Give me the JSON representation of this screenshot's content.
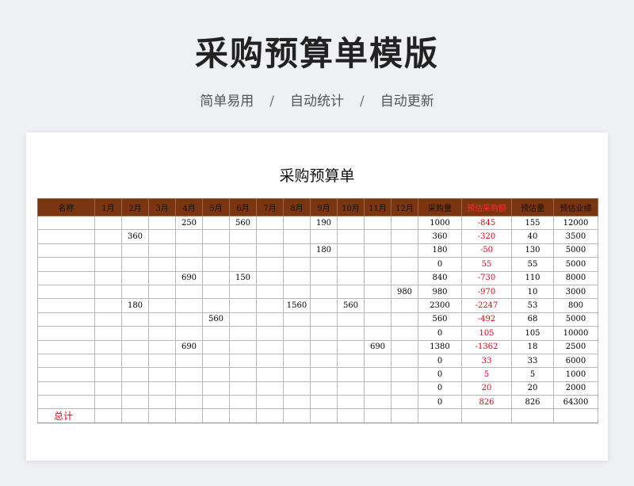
{
  "header": {
    "title": "采购预算单模版",
    "tags": [
      "简单易用",
      "自动统计",
      "自动更新"
    ],
    "separator": "/"
  },
  "sheet": {
    "title": "采购预算单",
    "columns": [
      "名称",
      "1月",
      "2月",
      "3月",
      "4月",
      "5月",
      "6月",
      "7月",
      "8月",
      "9月",
      "10月",
      "11月",
      "12月",
      "采购量",
      "预估采购额",
      "预估量",
      "预估业绩"
    ],
    "highlight_column_index": 14,
    "rows": [
      [
        "",
        "",
        "",
        "",
        "250",
        "",
        "560",
        "",
        "",
        "190",
        "",
        "",
        "",
        "1000",
        "-845",
        "155",
        "12000"
      ],
      [
        "",
        "",
        "360",
        "",
        "",
        "",
        "",
        "",
        "",
        "",
        "",
        "",
        "",
        "360",
        "-320",
        "40",
        "3500"
      ],
      [
        "",
        "",
        "",
        "",
        "",
        "",
        "",
        "",
        "",
        "180",
        "",
        "",
        "",
        "180",
        "-50",
        "130",
        "5000"
      ],
      [
        "",
        "",
        "",
        "",
        "",
        "",
        "",
        "",
        "",
        "",
        "",
        "",
        "",
        "0",
        "55",
        "55",
        "5000"
      ],
      [
        "",
        "",
        "",
        "",
        "690",
        "",
        "150",
        "",
        "",
        "",
        "",
        "",
        "",
        "840",
        "-730",
        "110",
        "8000"
      ],
      [
        "",
        "",
        "",
        "",
        "",
        "",
        "",
        "",
        "",
        "",
        "",
        "",
        "980",
        "980",
        "-970",
        "10",
        "3000"
      ],
      [
        "",
        "",
        "180",
        "",
        "",
        "",
        "",
        "",
        "1560",
        "",
        "560",
        "",
        "",
        "2300",
        "-2247",
        "53",
        "800"
      ],
      [
        "",
        "",
        "",
        "",
        "",
        "560",
        "",
        "",
        "",
        "",
        "",
        "",
        "",
        "560",
        "-492",
        "68",
        "5000"
      ],
      [
        "",
        "",
        "",
        "",
        "",
        "",
        "",
        "",
        "",
        "",
        "",
        "",
        "",
        "0",
        "105",
        "105",
        "10000"
      ],
      [
        "",
        "",
        "",
        "",
        "690",
        "",
        "",
        "",
        "",
        "",
        "",
        "690",
        "",
        "1380",
        "-1362",
        "18",
        "2500"
      ],
      [
        "",
        "",
        "",
        "",
        "",
        "",
        "",
        "",
        "",
        "",
        "",
        "",
        "",
        "0",
        "33",
        "33",
        "6000"
      ],
      [
        "",
        "",
        "",
        "",
        "",
        "",
        "",
        "",
        "",
        "",
        "",
        "",
        "",
        "0",
        "5",
        "5",
        "1000"
      ],
      [
        "",
        "",
        "",
        "",
        "",
        "",
        "",
        "",
        "",
        "",
        "",
        "",
        "",
        "0",
        "20",
        "20",
        "2000"
      ],
      [
        "",
        "",
        "",
        "",
        "",
        "",
        "",
        "",
        "",
        "",
        "",
        "",
        "",
        "0",
        "826",
        "826",
        "64300"
      ]
    ],
    "total_label": "总计",
    "colors": {
      "header_bg": "#7b3511",
      "highlight_text": "#ff2a2a",
      "negative_col_text": "#e60012"
    }
  }
}
